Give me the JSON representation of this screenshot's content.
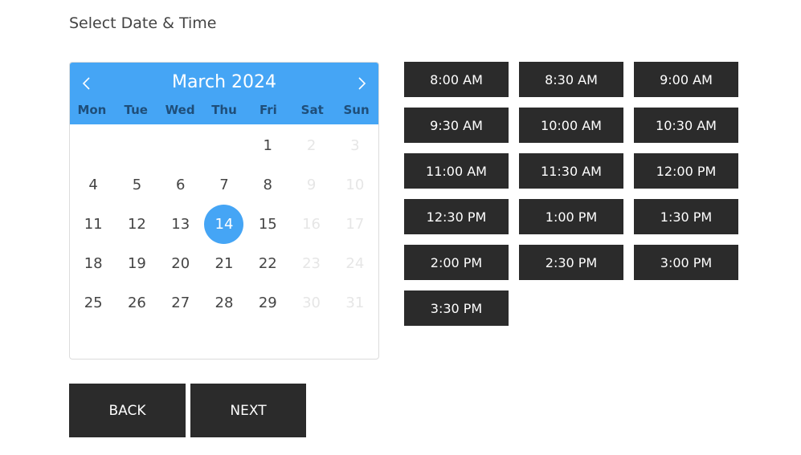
{
  "page": {
    "title": "Select Date & Time"
  },
  "calendar": {
    "month_label": "March 2024",
    "prev_icon": "chevron-left-icon",
    "next_icon": "chevron-right-icon",
    "weekdays": [
      "Mon",
      "Tue",
      "Wed",
      "Thu",
      "Fri",
      "Sat",
      "Sun"
    ],
    "leading_blanks": 4,
    "days": [
      {
        "d": "1",
        "state": "available"
      },
      {
        "d": "2",
        "state": "disabled"
      },
      {
        "d": "3",
        "state": "disabled"
      },
      {
        "d": "4",
        "state": "available"
      },
      {
        "d": "5",
        "state": "available"
      },
      {
        "d": "6",
        "state": "available"
      },
      {
        "d": "7",
        "state": "available"
      },
      {
        "d": "8",
        "state": "available"
      },
      {
        "d": "9",
        "state": "disabled"
      },
      {
        "d": "10",
        "state": "disabled"
      },
      {
        "d": "11",
        "state": "available"
      },
      {
        "d": "12",
        "state": "available"
      },
      {
        "d": "13",
        "state": "available"
      },
      {
        "d": "14",
        "state": "selected"
      },
      {
        "d": "15",
        "state": "available"
      },
      {
        "d": "16",
        "state": "disabled"
      },
      {
        "d": "17",
        "state": "disabled"
      },
      {
        "d": "18",
        "state": "available"
      },
      {
        "d": "19",
        "state": "available"
      },
      {
        "d": "20",
        "state": "available"
      },
      {
        "d": "21",
        "state": "available"
      },
      {
        "d": "22",
        "state": "available"
      },
      {
        "d": "23",
        "state": "disabled"
      },
      {
        "d": "24",
        "state": "disabled"
      },
      {
        "d": "25",
        "state": "available"
      },
      {
        "d": "26",
        "state": "available"
      },
      {
        "d": "27",
        "state": "available"
      },
      {
        "d": "28",
        "state": "available"
      },
      {
        "d": "29",
        "state": "available"
      },
      {
        "d": "30",
        "state": "disabled"
      },
      {
        "d": "31",
        "state": "disabled"
      }
    ],
    "selected_day": "14",
    "colors": {
      "accent": "#45a5f5",
      "weekday_text": "#1f4e79",
      "disabled_text": "#e6e6e6"
    }
  },
  "time_slots": [
    "8:00 AM",
    "8:30 AM",
    "9:00 AM",
    "9:30 AM",
    "10:00 AM",
    "10:30 AM",
    "11:00 AM",
    "11:30 AM",
    "12:00 PM",
    "12:30 PM",
    "1:00 PM",
    "1:30 PM",
    "2:00 PM",
    "2:30 PM",
    "3:00 PM",
    "3:30 PM"
  ],
  "actions": {
    "back_label": "BACK",
    "next_label": "NEXT"
  },
  "colors": {
    "button_bg": "#2b2b2b",
    "button_text": "#ffffff"
  }
}
